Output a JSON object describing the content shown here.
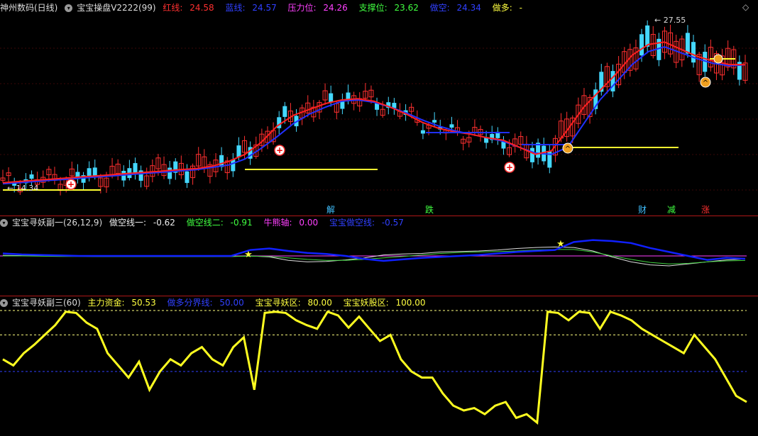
{
  "main": {
    "stock": "神州数码(日线)",
    "indicator": "宝宝操盘V2222(99)",
    "red_label": "红线:",
    "red_val": "24.58",
    "blue_label": "蓝线:",
    "blue_val": "24.57",
    "press_label": "压力位:",
    "press_val": "24.26",
    "support_label": "支撑位:",
    "support_val": "23.62",
    "short_label": "做空:",
    "short_val": "24.34",
    "long_label": "做多:",
    "long_val": "-",
    "high_label": "27.55",
    "low_label": "14.34",
    "tags": [
      "解",
      "跌",
      "财",
      "减",
      "涨"
    ],
    "colors": {
      "up": "#ff3030",
      "down": "#44d8ff",
      "red_line": "#ff2020",
      "blue_line": "#2030ff",
      "yellow": "#ffff30",
      "magenta": "#ff40ff"
    }
  },
  "ind1": {
    "title": "宝宝寻妖副一(26,12,9)",
    "short1_label": "做空线一:",
    "short1_val": "-0.62",
    "short2_label": "做空线二:",
    "short2_val": "-0.91",
    "bull_label": "牛熊轴:",
    "bull_val": "0.00",
    "hold_label": "宝宝做空线:",
    "hold_val": "-0.57"
  },
  "ind2": {
    "title": "宝宝寻妖副三(60)",
    "fund_label": "主力资金:",
    "fund_val": "50.53",
    "div_label": "做多分界线:",
    "div_val": "50.00",
    "zone_label": "宝宝寻妖区:",
    "zone_val": "80.00",
    "stock_label": "宝宝妖股区:",
    "stock_val": "100.00"
  },
  "chart_data": [
    {
      "type": "line",
      "title": "宝宝操盘V2222(99)",
      "series": [
        {
          "name": "红线",
          "values": [
            14.6,
            14.7,
            14.8,
            14.9,
            15.0,
            15.1,
            15.2,
            15.3,
            15.4,
            15.5,
            15.6,
            15.7,
            15.8,
            16.0,
            16.4,
            17.0,
            18.0,
            19.4,
            20.3,
            20.8,
            21.3,
            21.6,
            21.7,
            21.5,
            21.0,
            20.4,
            19.7,
            19.2,
            18.9,
            18.7,
            18.4,
            18.2,
            17.6,
            17.0,
            17.3,
            19.1,
            21.0,
            22.4,
            23.8,
            25.4,
            26.3,
            26.5,
            25.9,
            25.3,
            24.9,
            24.6,
            24.58
          ]
        },
        {
          "name": "蓝线",
          "values": [
            14.5,
            14.6,
            14.7,
            14.8,
            14.9,
            15.0,
            15.1,
            15.2,
            15.3,
            15.4,
            15.5,
            15.6,
            15.7,
            15.9,
            16.1,
            16.6,
            17.5,
            18.5,
            19.6,
            20.4,
            21.0,
            21.5,
            21.6,
            21.4,
            21.0,
            20.5,
            19.9,
            19.4,
            19.0,
            18.7,
            18.4,
            18.1,
            17.6,
            17.1,
            17.0,
            17.6,
            19.6,
            21.6,
            23.1,
            24.6,
            25.7,
            26.1,
            25.6,
            25.1,
            24.7,
            24.5,
            24.57
          ]
        }
      ],
      "levels": [
        {
          "name": "压力位",
          "value": 24.26
        },
        {
          "name": "支撑位",
          "value": 23.62
        },
        {
          "name": "做空",
          "value": 24.34
        }
      ],
      "high": 27.55,
      "low": 14.34
    },
    {
      "type": "line",
      "title": "宝宝寻妖副一(26,12,9)",
      "series": [
        {
          "name": "做空线一",
          "values": [
            0.1,
            0.05,
            0.02,
            0.0,
            -0.05,
            -0.1,
            -0.1,
            -0.1,
            -0.1,
            -0.1,
            -0.1,
            -0.1,
            -0.1,
            0.0,
            -0.2,
            -0.9,
            -1.2,
            -1.1,
            -0.8,
            -0.4,
            0.2,
            0.4,
            0.5,
            0.8,
            0.9,
            1.0,
            1.2,
            1.5,
            1.7,
            1.8,
            1.7,
            1.0,
            -0.2,
            -1.2,
            -1.8,
            -2.0,
            -1.6,
            -1.2,
            -0.8,
            -0.62
          ]
        },
        {
          "name": "做空线二",
          "values": [
            0.0,
            0.0,
            -0.05,
            -0.1,
            -0.1,
            -0.15,
            -0.15,
            -0.15,
            -0.15,
            -0.15,
            -0.15,
            -0.15,
            -0.1,
            -0.05,
            -0.1,
            -0.4,
            -0.7,
            -0.9,
            -0.9,
            -0.7,
            -0.4,
            -0.1,
            0.2,
            0.5,
            0.7,
            0.8,
            0.9,
            1.0,
            1.2,
            1.3,
            1.3,
            0.8,
            0.0,
            -0.7,
            -1.3,
            -1.6,
            -1.5,
            -1.2,
            -1.0,
            -0.91
          ]
        },
        {
          "name": "牛熊轴",
          "values": [
            0.0
          ]
        },
        {
          "name": "宝宝做空线",
          "values": [
            0.5,
            0.3,
            0.2,
            0.1,
            0.0,
            0.0,
            0.0,
            0.0,
            0.0,
            0.0,
            0.0,
            0.0,
            0.0,
            1.2,
            1.5,
            1.0,
            0.6,
            0.4,
            0.0,
            -0.6,
            -1.0,
            -0.7,
            -0.4,
            -0.2,
            0.0,
            0.2,
            0.5,
            0.8,
            1.0,
            1.2,
            2.8,
            3.2,
            3.0,
            2.6,
            1.6,
            0.8,
            0.0,
            -0.8,
            -0.4,
            -0.57
          ]
        }
      ]
    },
    {
      "type": "line",
      "title": "宝宝寻妖副三(60)",
      "ylim": [
        0,
        100
      ],
      "series": [
        {
          "name": "主力资金",
          "values": [
            60,
            55,
            65,
            72,
            80,
            88,
            99,
            98,
            90,
            85,
            65,
            55,
            45,
            58,
            35,
            50,
            60,
            55,
            65,
            70,
            60,
            55,
            70,
            78,
            35,
            98,
            99,
            98,
            92,
            88,
            85,
            99,
            96,
            86,
            95,
            85,
            75,
            80,
            60,
            50,
            45,
            45,
            32,
            22,
            18,
            20,
            15,
            22,
            25,
            12,
            15,
            8,
            99,
            98,
            92,
            99,
            98,
            85,
            99,
            96,
            92,
            85,
            80,
            75,
            70,
            65,
            80,
            70,
            60,
            45,
            30,
            25
          ]
        },
        {
          "name": "做多分界线",
          "values": [
            50
          ]
        },
        {
          "name": "宝宝寻妖区",
          "values": [
            80
          ]
        },
        {
          "name": "宝宝妖股区",
          "values": [
            100
          ]
        }
      ]
    }
  ]
}
